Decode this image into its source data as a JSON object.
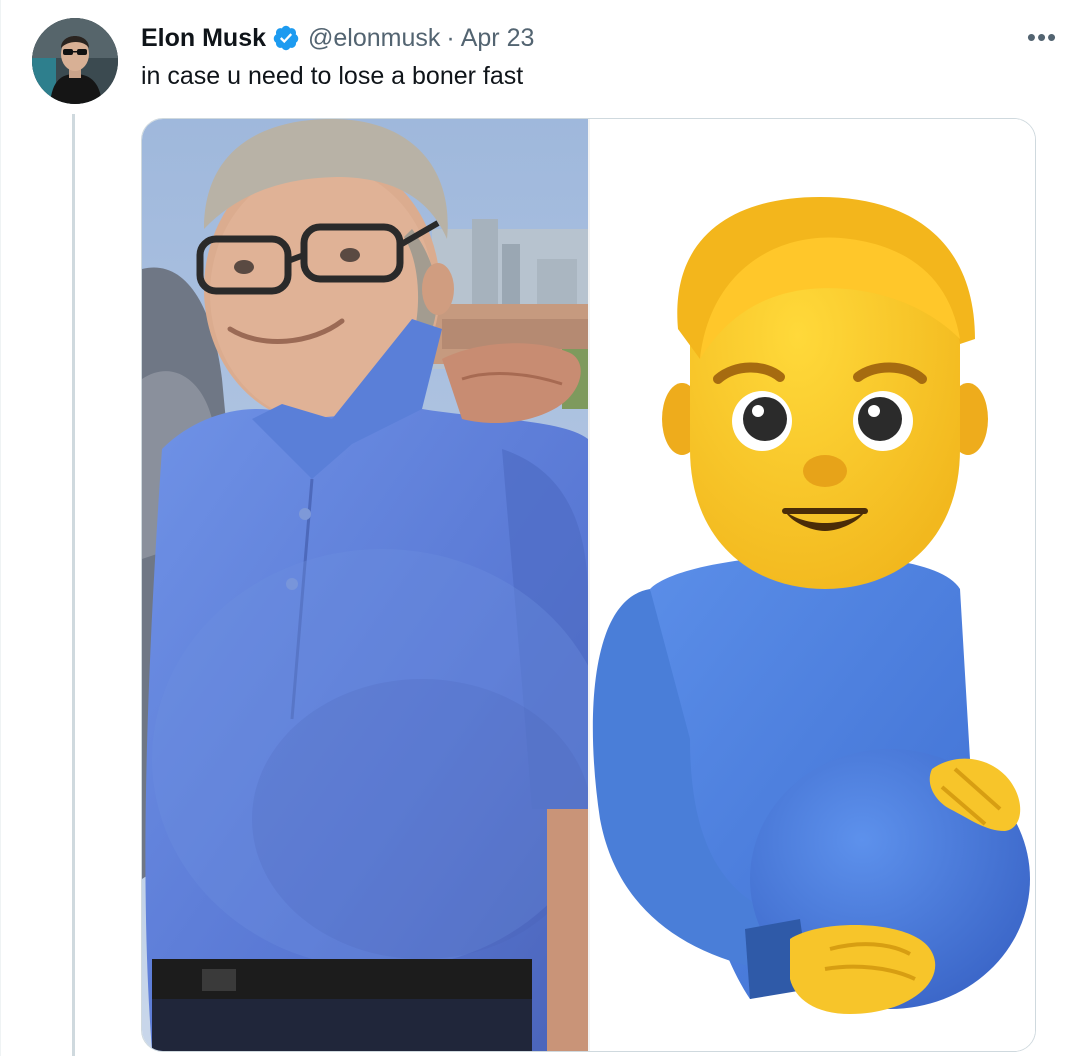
{
  "tweet": {
    "author_name": "Elon Musk",
    "handle": "@elonmusk",
    "separator": "·",
    "date": "Apr 23",
    "text": "in case u need to lose a boner fast",
    "more_icon": "more-horizontal-icon",
    "more_label": "•••",
    "verified_icon": "verified-badge-icon"
  },
  "colors": {
    "verified": "#1d9bf0",
    "secondary_text": "#536471",
    "thread_line": "#cfd9de",
    "shirt_blue": "#5b7fd6",
    "emoji_yellow": "#f7c527"
  }
}
